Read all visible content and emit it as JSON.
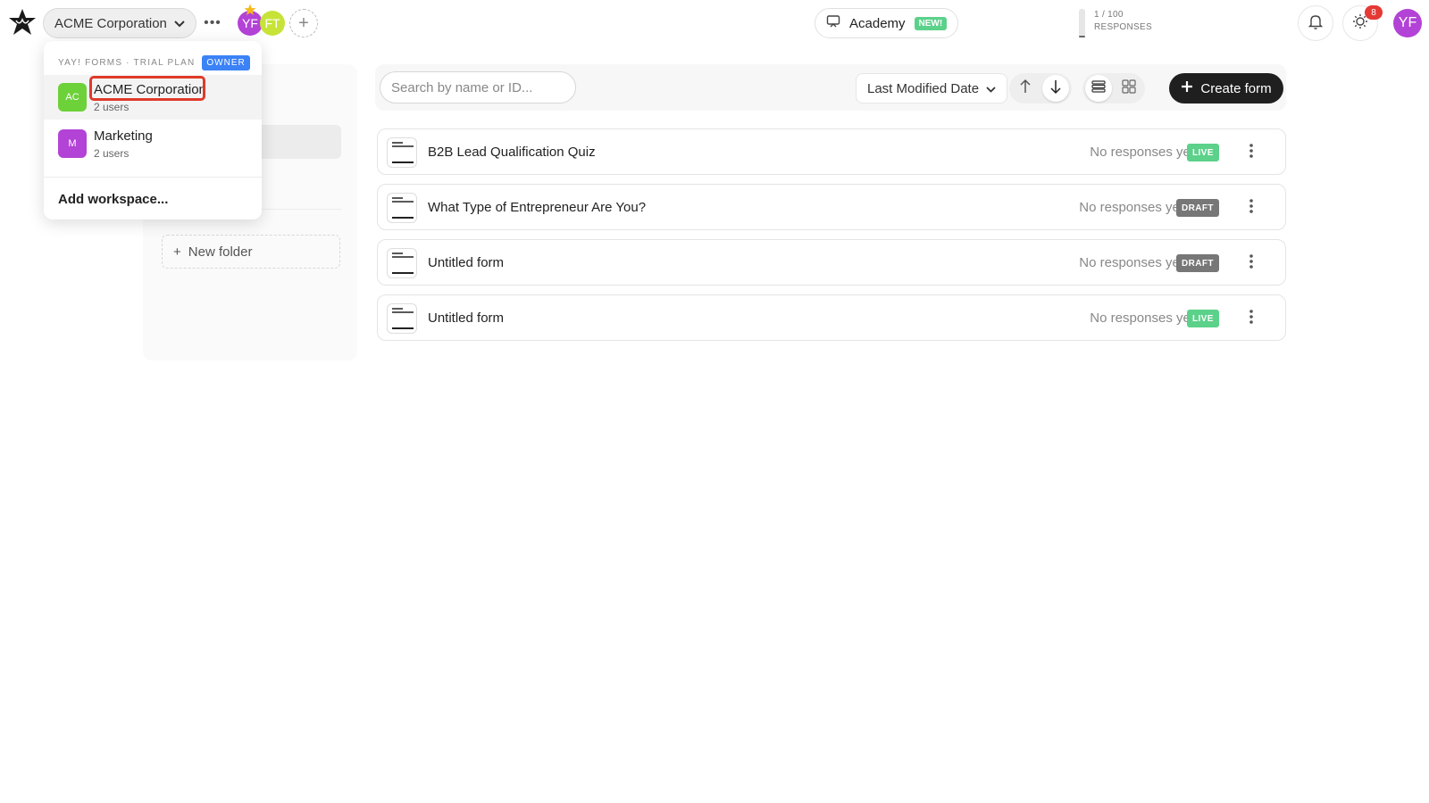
{
  "header": {
    "workspace_label": "ACME Corporation",
    "more_label": "•••",
    "members": [
      {
        "initials": "YF",
        "color": "#b342d6"
      },
      {
        "initials": "FT",
        "color": "#c7e338"
      }
    ],
    "academy_label": "Academy",
    "academy_badge": "NEW!",
    "usage_label": "1 / 100",
    "usage_unit": "RESPONSES",
    "usage_fraction": 0.01,
    "notification_count": "8",
    "user_initials": "YF"
  },
  "dropdown": {
    "brand": "YAY! FORMS · TRIAL PLAN",
    "role_badge": "OWNER",
    "workspaces": [
      {
        "icon": "AC",
        "name": "ACME Corporation",
        "users": "2 users",
        "color": "#6dd13a",
        "active": true
      },
      {
        "icon": "M",
        "name": "Marketing",
        "users": "2 users",
        "color": "#b342d6",
        "active": false
      }
    ],
    "add_label": "Add workspace..."
  },
  "sidebar": {
    "new_folder_label": "New folder"
  },
  "toolbar": {
    "search_placeholder": "Search by name or ID...",
    "sort_label": "Last Modified Date",
    "create_label": "Create form"
  },
  "forms": [
    {
      "name": "B2B Lead Qualification Quiz",
      "responses": "No responses yet",
      "status": "LIVE"
    },
    {
      "name": "What Type of Entrepreneur Are You?",
      "responses": "No responses yet",
      "status": "DRAFT"
    },
    {
      "name": "Untitled form",
      "responses": "No responses yet",
      "status": "DRAFT"
    },
    {
      "name": "Untitled form",
      "responses": "No responses yet",
      "status": "LIVE"
    }
  ],
  "colors": {
    "live": "#5bd18a",
    "draft": "#777777",
    "accent": "#b342d6",
    "highlight": "#e03a2a"
  }
}
